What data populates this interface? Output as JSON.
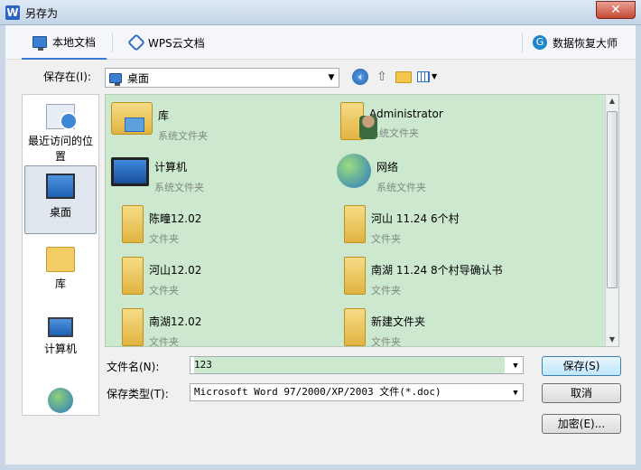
{
  "window": {
    "title": "另存为",
    "app_icon": "W",
    "close": "✕"
  },
  "tabs": [
    {
      "label": "本地文档",
      "icon": "monitor-icon"
    },
    {
      "label": "WPS云文档",
      "icon": "cloud-icon"
    },
    {
      "label": "数据恢复大师",
      "icon": "recover-icon"
    }
  ],
  "save_in": {
    "label": "保存在(I):",
    "value": "桌面"
  },
  "places": [
    {
      "label": "最近访问的位置",
      "icon": "recent-icon"
    },
    {
      "label": "桌面",
      "icon": "desktop-icon",
      "active": true
    },
    {
      "label": "库",
      "icon": "library-icon"
    },
    {
      "label": "计算机",
      "icon": "computer-icon"
    },
    {
      "label": "网络",
      "icon": "network-icon"
    }
  ],
  "items": [
    {
      "name": "库",
      "type": "系统文件夹",
      "icon": "library-icon"
    },
    {
      "name": "Administrator",
      "type": "系统文件夹",
      "icon": "user-folder-icon"
    },
    {
      "name": "计算机",
      "type": "系统文件夹",
      "icon": "computer-icon"
    },
    {
      "name": "网络",
      "type": "系统文件夹",
      "icon": "network-icon"
    },
    {
      "name": "陈疃12.02",
      "type": "文件夹",
      "icon": "folder-icon"
    },
    {
      "name": "河山 11.24  6个村",
      "type": "文件夹",
      "icon": "folder-icon"
    },
    {
      "name": "河山12.02",
      "type": "文件夹",
      "icon": "folder-icon"
    },
    {
      "name": "南湖 11.24 8个村导确认书",
      "type": "文件夹",
      "icon": "folder-icon"
    },
    {
      "name": "南湖12.02",
      "type": "文件夹",
      "icon": "folder-icon"
    },
    {
      "name": "新建文件夹",
      "type": "文件夹",
      "icon": "folder-icon"
    }
  ],
  "form": {
    "filename_label": "文件名(N):",
    "filename_value": "123",
    "filetype_label": "保存类型(T):",
    "filetype_value": "Microsoft Word 97/2000/XP/2003 文件(*.doc)"
  },
  "buttons": {
    "save": "保存(S)",
    "cancel": "取消",
    "encrypt": "加密(E)..."
  }
}
